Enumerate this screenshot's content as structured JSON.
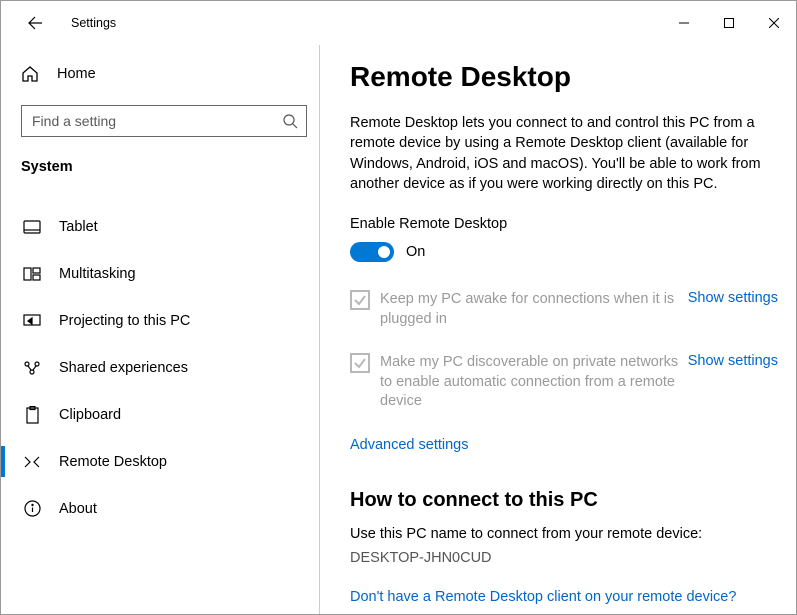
{
  "titlebar": {
    "title": "Settings"
  },
  "sidebar": {
    "home_label": "Home",
    "search_placeholder": "Find a setting",
    "category": "System",
    "items": [
      {
        "label": "Tablet"
      },
      {
        "label": "Multitasking"
      },
      {
        "label": "Projecting to this PC"
      },
      {
        "label": "Shared experiences"
      },
      {
        "label": "Clipboard"
      },
      {
        "label": "Remote Desktop"
      },
      {
        "label": "About"
      }
    ]
  },
  "main": {
    "heading": "Remote Desktop",
    "description": "Remote Desktop lets you connect to and control this PC from a remote device by using a Remote Desktop client (available for Windows, Android, iOS and macOS). You'll be able to work from another device as if you were working directly on this PC.",
    "enable_label": "Enable Remote Desktop",
    "toggle_state": "On",
    "check1_text": "Keep my PC awake for connections when it is plugged in",
    "check2_text": "Make my PC discoverable on private networks to enable automatic connection from a remote device",
    "show_settings": "Show settings",
    "advanced_link": "Advanced settings",
    "connect_heading": "How to connect to this PC",
    "connect_info": "Use this PC name to connect from your remote device:",
    "pc_name": "DESKTOP-JHN0CUD",
    "help_link": "Don't have a Remote Desktop client on your remote device?"
  }
}
